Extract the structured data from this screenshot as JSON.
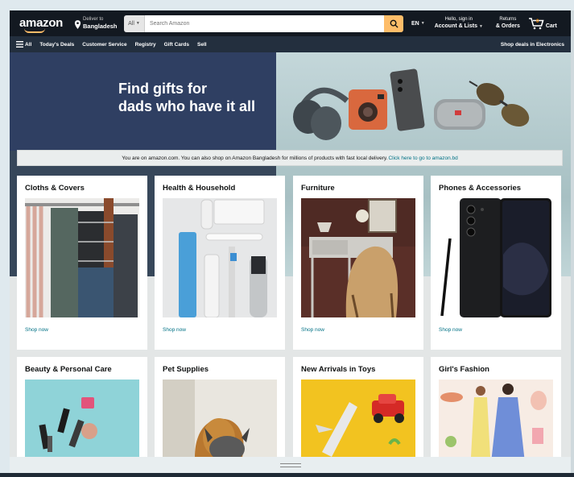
{
  "header": {
    "logo": "amazon",
    "deliver_small": "Deliver to",
    "deliver_location": "Bangladesh",
    "search_category": "All",
    "search_placeholder": "Search Amazon",
    "language": "EN",
    "account_small": "Hello, sign in",
    "account_big": "Account & Lists",
    "returns_small": "Returns",
    "returns_big": "& Orders",
    "cart_label": "Cart",
    "cart_count": "0"
  },
  "subnav": {
    "all_label": "All",
    "links": [
      "Today's Deals",
      "Customer Service",
      "Registry",
      "Gift Cards",
      "Sell"
    ],
    "right_link": "Shop deals in Electronics"
  },
  "hero": {
    "line1": "Find gifts for",
    "line2": "dads who have it all"
  },
  "notice": {
    "text": "You are on amazon.com. You can also shop on Amazon Bangladesh for millions of products with fast local delivery.",
    "link": "Click here to go to amazon.bd"
  },
  "cards": [
    {
      "title": "Cloths & Covers",
      "link": "Shop now"
    },
    {
      "title": "Health & Household",
      "link": "Shop now"
    },
    {
      "title": "Furniture",
      "link": "Shop now"
    },
    {
      "title": "Phones & Accessories",
      "link": "Shop now"
    },
    {
      "title": "Beauty & Personal Care"
    },
    {
      "title": "Pet Supplies"
    },
    {
      "title": "New Arrivals in Toys"
    },
    {
      "title": "Girl's Fashion"
    }
  ],
  "colors": {
    "nav_dark": "#131921",
    "nav_secondary": "#232f3e",
    "search_button": "#febd69",
    "link": "#007185"
  }
}
